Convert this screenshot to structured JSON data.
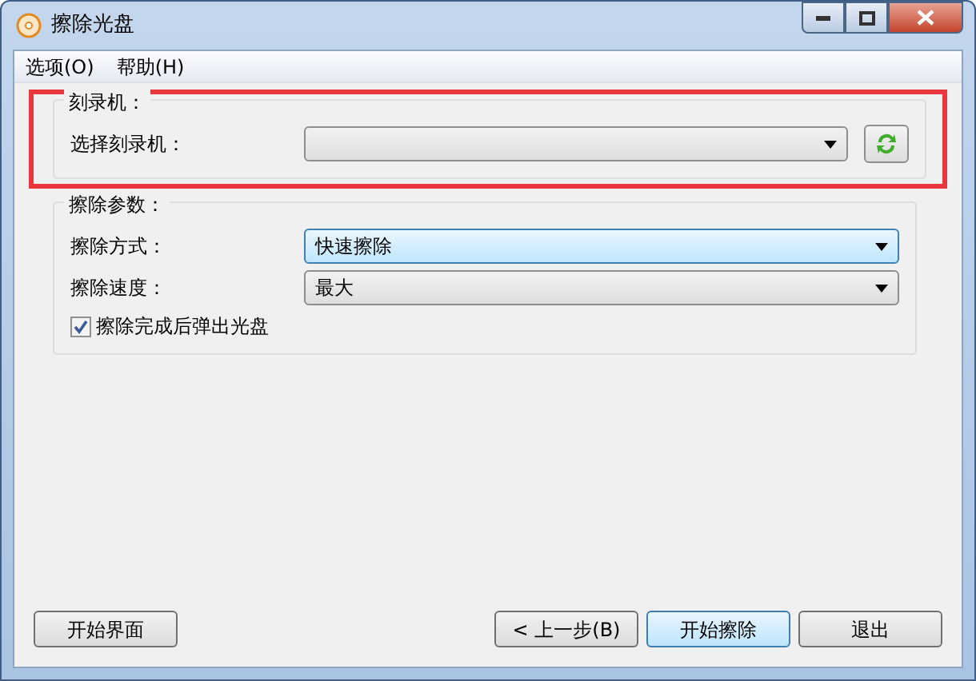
{
  "window": {
    "title": "擦除光盘"
  },
  "menu": [
    {
      "label": "选项(O)"
    },
    {
      "label": "帮助(H)"
    }
  ],
  "burner_group": {
    "title": "刻录机：",
    "highlighted": true,
    "label": "选择刻录机："
  },
  "params_group": {
    "title": "擦除参数：",
    "fields": [
      {
        "label": "擦除方式：",
        "value": "快速擦除",
        "focused": true
      },
      {
        "label": "擦除速度：",
        "value": "最大",
        "focused": false
      }
    ],
    "eject": {
      "label": "擦除完成后弹出光盘",
      "checked": true
    }
  },
  "buttons": [
    {
      "label": "开始界面",
      "default": false
    },
    {
      "label": "< 上一步(B)",
      "default": false
    },
    {
      "label": "开始擦除",
      "default": true
    },
    {
      "label": "退出",
      "default": false
    }
  ]
}
